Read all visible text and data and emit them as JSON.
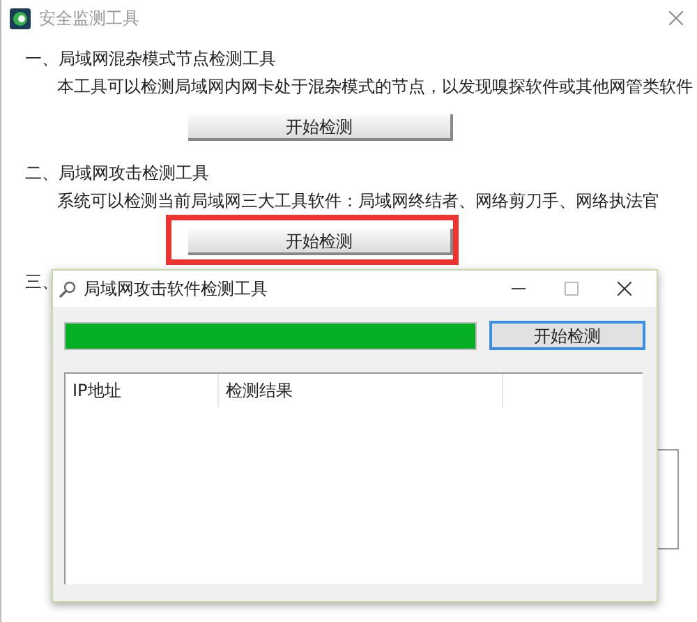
{
  "window": {
    "title": "安全监测工具"
  },
  "sections": [
    {
      "heading": "一、局域网混杂模式节点检测工具",
      "description": "本工具可以检测局域网内网卡处于混杂模式的节点，以发现嗅探软件或其他网管类软件",
      "button": "开始检测",
      "highlighted": false
    },
    {
      "heading": "二、局域网攻击检测工具",
      "description": "系统可以检测当前局域网三大工具软件：局域网终结者、网络剪刀手、网络执法官",
      "button": "开始检测",
      "highlighted": true
    }
  ],
  "section_3": {
    "heading": "三、"
  },
  "dialog": {
    "title": "局域网攻击软件检测工具",
    "progress": {
      "level": 1
    },
    "button": "开始检测",
    "table": {
      "columns": [
        "IP地址",
        "检测结果"
      ]
    }
  }
}
